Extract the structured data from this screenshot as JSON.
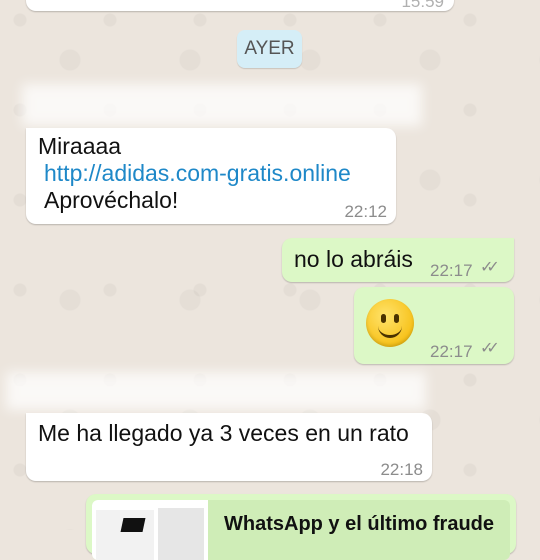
{
  "colors": {
    "background": "#ECE5DD",
    "incoming_bubble": "#FFFFFF",
    "outgoing_bubble": "#DCF8C6",
    "date_chip": "#D5EEF7",
    "link": "#1E88C8",
    "meta": "#8C8C8C"
  },
  "top_partial": {
    "time": "15:59"
  },
  "date_chip": "AYER",
  "messages": [
    {
      "direction": "incoming",
      "line1": "Miraaaa",
      "link": "http://adidas.com-gratis.online",
      "line3": "Aprovéchalo!",
      "time": "22:12"
    },
    {
      "direction": "outgoing",
      "text": "no lo abráis",
      "time": "22:17",
      "status": "read"
    },
    {
      "direction": "outgoing",
      "emoji": "🙂",
      "time": "22:17",
      "status": "read"
    },
    {
      "direction": "incoming",
      "text": "Me ha llegado ya 3 veces en un rato",
      "time": "22:18"
    }
  ],
  "link_preview": {
    "title": "WhatsApp y el último fraude"
  },
  "icons": {
    "read_receipt": "double-check-icon"
  }
}
